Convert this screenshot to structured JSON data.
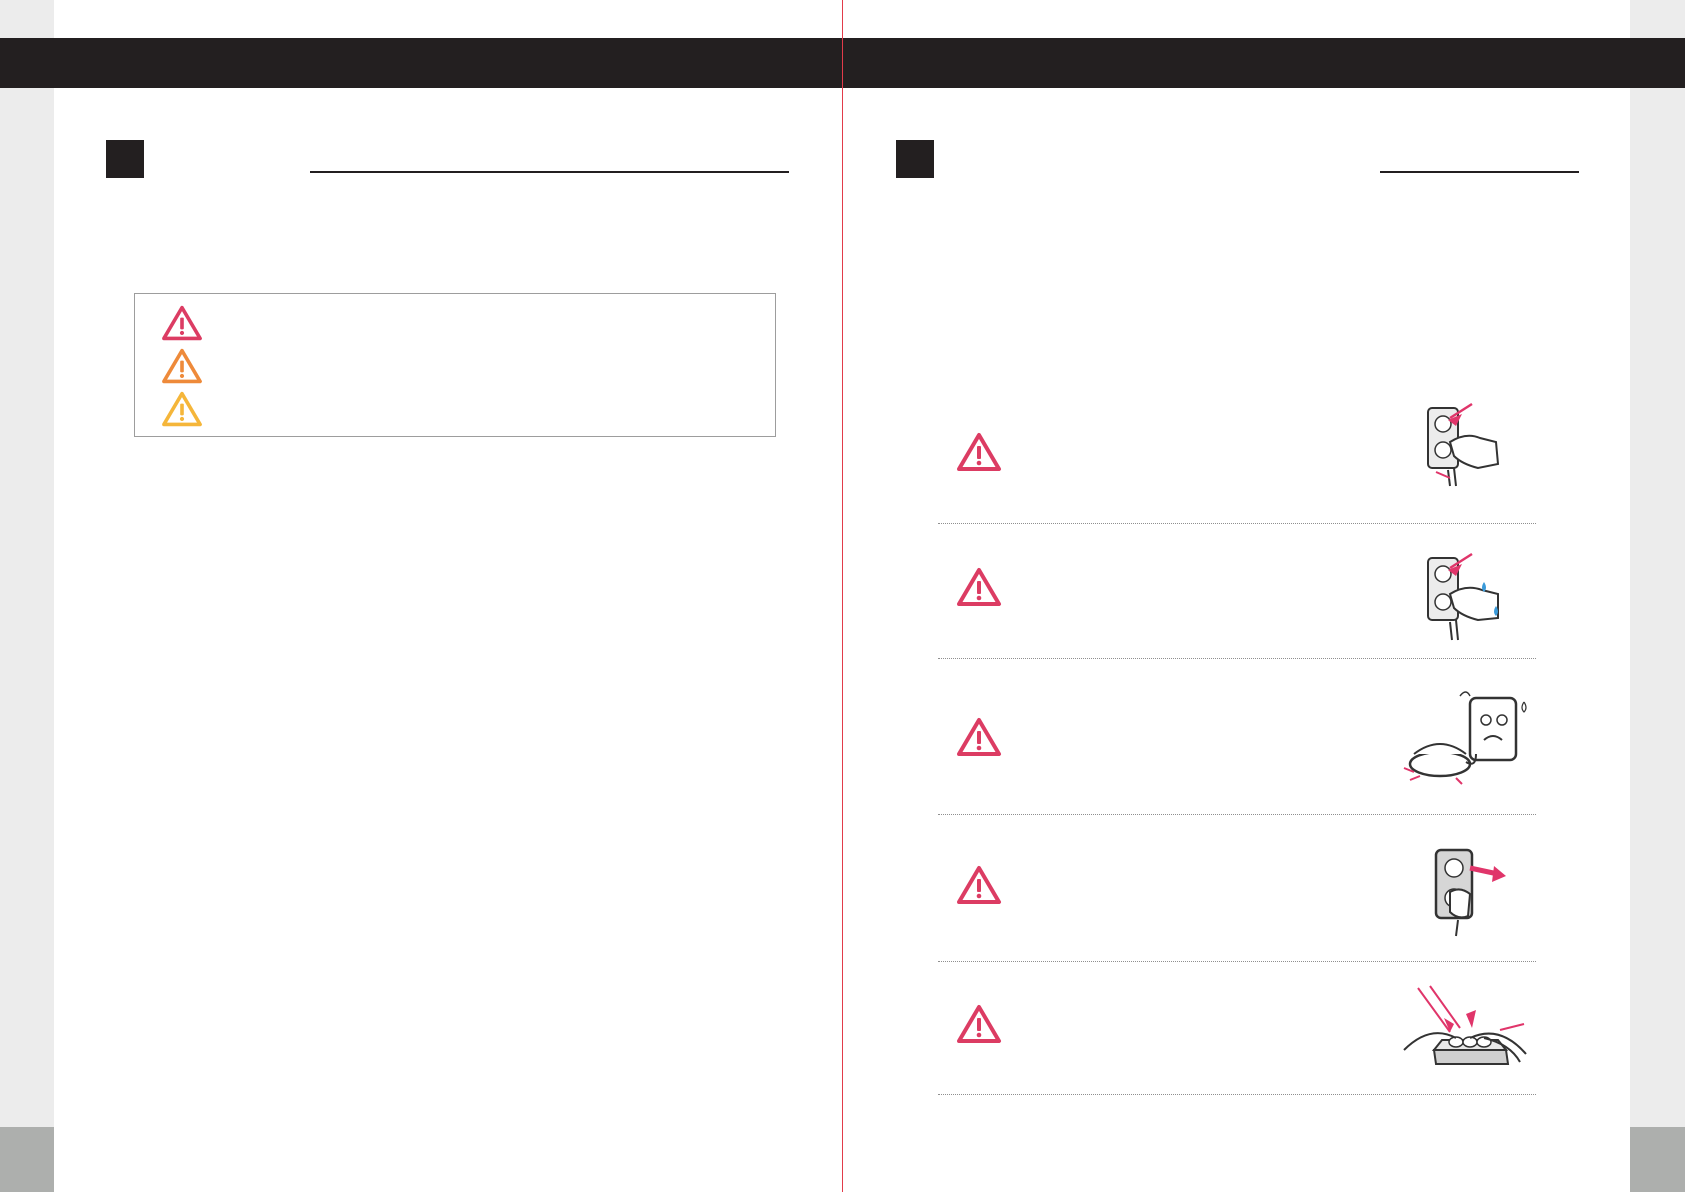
{
  "colors": {
    "danger": "#dc3c63",
    "warning": "#ee8a3a",
    "caution": "#f5b63a",
    "header_bar": "#231f20",
    "spine": "#e23b4a",
    "page_edge": "#ececec",
    "page_foot": "#adafad"
  },
  "legend_icons": [
    {
      "icon": "danger-triangle-icon"
    },
    {
      "icon": "warning-triangle-icon"
    },
    {
      "icon": "caution-triangle-icon"
    }
  ],
  "warnings": [
    {
      "icon": "danger-triangle-icon",
      "illustration": "hand-plugging-cord-illustration"
    },
    {
      "icon": "danger-triangle-icon",
      "illustration": "wet-hand-outlet-illustration"
    },
    {
      "icon": "danger-triangle-icon",
      "illustration": "heated-appliance-illustration"
    },
    {
      "icon": "danger-triangle-icon",
      "illustration": "plug-pulled-illustration"
    },
    {
      "icon": "danger-triangle-icon",
      "illustration": "overloaded-power-strip-illustration"
    }
  ]
}
